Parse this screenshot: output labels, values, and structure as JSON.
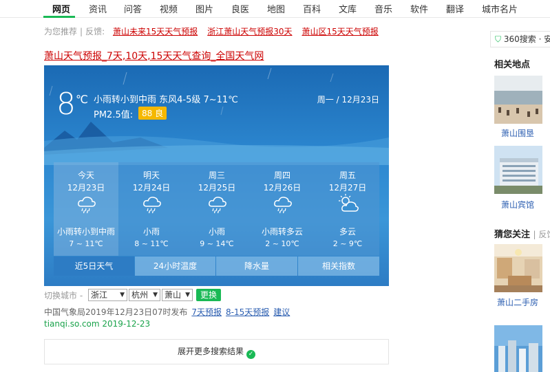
{
  "nav": {
    "items": [
      "网页",
      "资讯",
      "问答",
      "视频",
      "图片",
      "良医",
      "地图",
      "百科",
      "文库",
      "音乐",
      "软件",
      "翻译",
      "城市名片"
    ]
  },
  "recommend": {
    "label": "为您推荐",
    "feedback": "反馈:",
    "links": [
      "萧山未来15天天气预报",
      "浙江萧山天气预报30天",
      "萧山区15天天气预报"
    ]
  },
  "result": {
    "title": "萧山天气预报_7天,10天,15天天气查询_全国天气网",
    "publish_text": "中国气象局2019年12月23日07时发布",
    "links": [
      "7天预报",
      "8-15天预报",
      "建议"
    ],
    "source": "tianqi.so.com 2019-12-23",
    "more_label": "展开更多搜索结果"
  },
  "weather": {
    "current_temp": "8",
    "temp_unit": "℃",
    "condition": "小雨转小到中雨  东风4-5级  7~11℃",
    "pm_label": "PM2.5值:",
    "pm_value": "88 良",
    "date": "周一 / 12月23日",
    "days": [
      {
        "name": "今天",
        "date": "12月23日",
        "icon": "rain-cloud-icon",
        "desc": "小雨转小到中雨",
        "range": "7 ~ 11℃"
      },
      {
        "name": "明天",
        "date": "12月24日",
        "icon": "rain-cloud-icon",
        "desc": "小雨",
        "range": "8 ~ 11℃"
      },
      {
        "name": "周三",
        "date": "12月25日",
        "icon": "rain-cloud-icon",
        "desc": "小雨",
        "range": "9 ~ 14℃"
      },
      {
        "name": "周四",
        "date": "12月26日",
        "icon": "rain-cloud-icon",
        "desc": "小雨转多云",
        "range": "2 ~ 10℃"
      },
      {
        "name": "周五",
        "date": "12月27日",
        "icon": "sun-cloud-icon",
        "desc": "多云",
        "range": "2 ~ 9℃"
      }
    ],
    "tabs": [
      "近5日天气",
      "24小时温度",
      "降水量",
      "相关指数"
    ]
  },
  "switch": {
    "label": "切换城市 -",
    "province": "浙江",
    "city": "杭州",
    "district": "萧山",
    "button": "更换"
  },
  "sidebar": {
    "badge_text": "360搜索 · 安",
    "related_places_title": "相关地点",
    "places": [
      "萧山围垦",
      "萧山宾馆"
    ],
    "guess_title": "猜您关注",
    "guess_feedback": "| 反馈",
    "guess_items": [
      "萧山二手房"
    ]
  },
  "colors": {
    "accent": "#19b955",
    "link_red": "#cc0000",
    "card_blue": "#2c87d0",
    "pm_badge": "#f5b800"
  }
}
